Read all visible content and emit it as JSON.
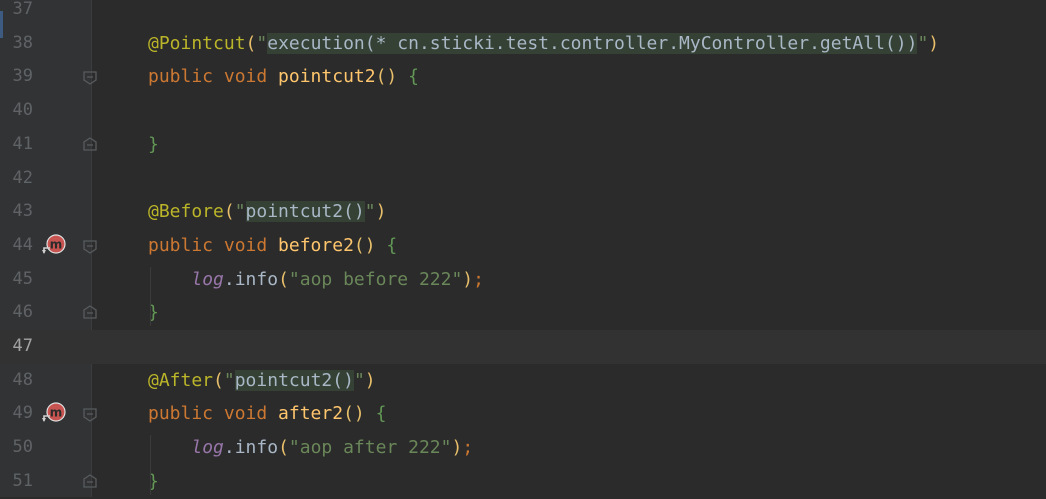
{
  "editor": {
    "current_line": "47",
    "lines": [
      {
        "num": "37"
      },
      {
        "num": "38",
        "parts": [
          {
            "t": "@Pointcut",
            "c": "ann"
          },
          {
            "t": "(",
            "c": "paren"
          },
          {
            "t": "\"",
            "c": "str"
          },
          {
            "t": "execution(* cn.sticki.test.controller.MyController.getAll())",
            "c": "inj hl"
          },
          {
            "t": "\"",
            "c": "str"
          },
          {
            "t": ")",
            "c": "paren"
          }
        ]
      },
      {
        "num": "39",
        "parts": [
          {
            "t": "public ",
            "c": "kw"
          },
          {
            "t": "void ",
            "c": "kw"
          },
          {
            "t": "pointcut2",
            "c": "fn"
          },
          {
            "t": "() ",
            "c": "paren"
          },
          {
            "t": "{",
            "c": "brace"
          }
        ]
      },
      {
        "num": "40",
        "parts": []
      },
      {
        "num": "41",
        "parts": [
          {
            "t": "}",
            "c": "brace"
          }
        ]
      },
      {
        "num": "42",
        "parts": []
      },
      {
        "num": "43",
        "parts": [
          {
            "t": "@Before",
            "c": "ann"
          },
          {
            "t": "(",
            "c": "paren"
          },
          {
            "t": "\"",
            "c": "str"
          },
          {
            "t": "pointcut2()",
            "c": "inj hl"
          },
          {
            "t": "\"",
            "c": "str"
          },
          {
            "t": ")",
            "c": "paren"
          }
        ]
      },
      {
        "num": "44",
        "parts": [
          {
            "t": "public ",
            "c": "kw"
          },
          {
            "t": "void ",
            "c": "kw"
          },
          {
            "t": "before2",
            "c": "fn"
          },
          {
            "t": "() ",
            "c": "paren"
          },
          {
            "t": "{",
            "c": "brace"
          }
        ]
      },
      {
        "num": "45",
        "parts": [
          {
            "t": "    ",
            "c": ""
          },
          {
            "t": "log",
            "c": "field"
          },
          {
            "t": ".info",
            "c": ""
          },
          {
            "t": "(",
            "c": "paren"
          },
          {
            "t": "\"aop before 222\"",
            "c": "str"
          },
          {
            "t": ")",
            "c": "paren"
          },
          {
            "t": ";",
            "c": "kw"
          }
        ]
      },
      {
        "num": "46",
        "parts": [
          {
            "t": "}",
            "c": "brace"
          }
        ]
      },
      {
        "num": "47",
        "parts": []
      },
      {
        "num": "48",
        "parts": [
          {
            "t": "@After",
            "c": "ann"
          },
          {
            "t": "(",
            "c": "paren"
          },
          {
            "t": "\"",
            "c": "str"
          },
          {
            "t": "pointcut2()",
            "c": "inj hl"
          },
          {
            "t": "\"",
            "c": "str"
          },
          {
            "t": ")",
            "c": "paren"
          }
        ]
      },
      {
        "num": "49",
        "parts": [
          {
            "t": "public ",
            "c": "kw"
          },
          {
            "t": "void ",
            "c": "kw"
          },
          {
            "t": "after2",
            "c": "fn"
          },
          {
            "t": "() ",
            "c": "paren"
          },
          {
            "t": "{",
            "c": "brace"
          }
        ]
      },
      {
        "num": "50",
        "parts": [
          {
            "t": "    ",
            "c": ""
          },
          {
            "t": "log",
            "c": "field"
          },
          {
            "t": ".info",
            "c": ""
          },
          {
            "t": "(",
            "c": "paren"
          },
          {
            "t": "\"aop after 222\"",
            "c": "str"
          },
          {
            "t": ")",
            "c": "paren"
          },
          {
            "t": ";",
            "c": "kw"
          }
        ]
      },
      {
        "num": "51",
        "parts": [
          {
            "t": "}",
            "c": "brace"
          }
        ]
      }
    ],
    "fold_open_lines": [
      "39",
      "44",
      "49"
    ],
    "fold_close_lines": [
      "41",
      "46",
      "51"
    ],
    "method_marker_lines": [
      "44",
      "49"
    ],
    "method_marker_glyph": "m",
    "icons": {
      "fold_open": "fold-open-icon",
      "fold_close": "fold-close-icon",
      "method_marker": "aop-advice-method-icon"
    }
  }
}
